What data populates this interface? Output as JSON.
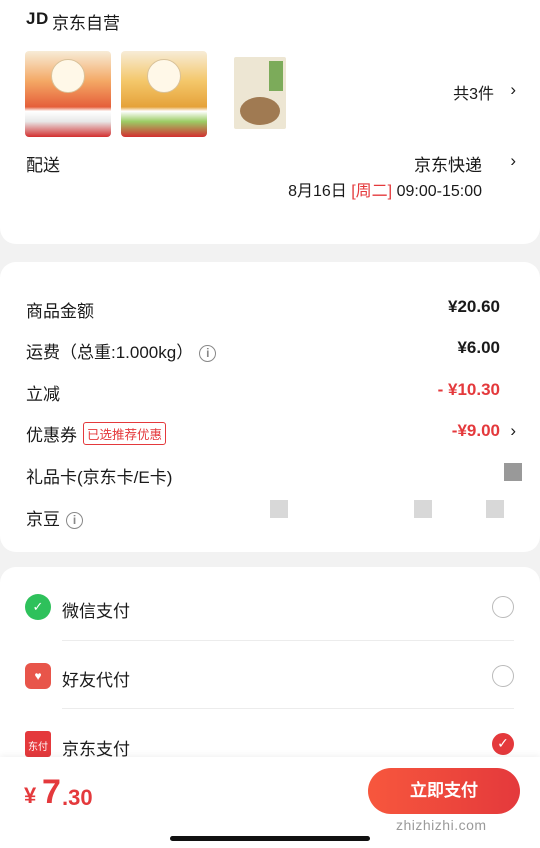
{
  "shop": {
    "logo_text": "JD",
    "name": "京东自营"
  },
  "order": {
    "items": [
      {
        "name": "pickle-jar-1-icon"
      },
      {
        "name": "pickle-jar-2-icon"
      },
      {
        "name": "hotpot-seasoning-pack-icon"
      }
    ],
    "total_count": "共3件"
  },
  "delivery": {
    "label": "配送",
    "method": "京东快递",
    "date": "8月16日",
    "weekday": "[周二]",
    "time_range": "09:00-15:00"
  },
  "amounts": {
    "goods_label": "商品金额",
    "goods_value": "¥20.60",
    "shipping_label": "运费（总重:1.000kg）",
    "shipping_value": "¥6.00",
    "discount_label": "立减",
    "discount_value": "- ¥10.30",
    "coupon_label": "优惠券",
    "coupon_tag": "已选推荐优惠",
    "coupon_value": "-¥9.00",
    "giftcard_label": "礼品卡(京东卡/E卡)",
    "jingdou_label": "京豆"
  },
  "payment": {
    "methods": [
      {
        "label": "微信支付",
        "icon": "wechat-pay-icon",
        "selected": false
      },
      {
        "label": "好友代付",
        "icon": "friend-pay-icon",
        "selected": false
      },
      {
        "label": "京东支付",
        "icon": "jd-pay-icon",
        "selected": true
      }
    ],
    "jdpay_icon_text": "东付",
    "friend_icon_text": "♥"
  },
  "bottom": {
    "currency": "¥",
    "price_int": "7",
    "price_dec": ".30",
    "submit_label": "立即支付",
    "watermark": "zhizhizhi.com"
  },
  "colors": {
    "accent": "#e4393c",
    "wechat": "#2ec15b"
  }
}
